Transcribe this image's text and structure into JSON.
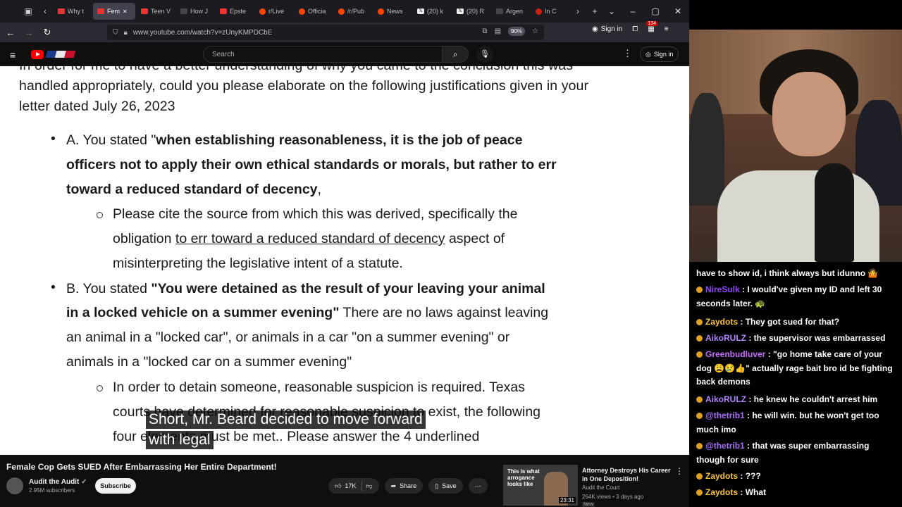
{
  "browser": {
    "tabs": [
      {
        "label": "Why t",
        "active": false,
        "icon": "youtube-icon"
      },
      {
        "label": "Fem",
        "active": true,
        "icon": "youtube-icon"
      },
      {
        "label": "Teen V",
        "active": false,
        "icon": "youtube-icon"
      },
      {
        "label": "How J",
        "active": false,
        "icon": "page-icon"
      },
      {
        "label": "Epste",
        "active": false,
        "icon": "youtube-icon"
      },
      {
        "label": "r/Live",
        "active": false,
        "icon": "reddit-icon"
      },
      {
        "label": "Officia",
        "active": false,
        "icon": "reddit-icon"
      },
      {
        "label": "/r/Pub",
        "active": false,
        "icon": "reddit-icon"
      },
      {
        "label": "News",
        "active": false,
        "icon": "reddit-icon"
      },
      {
        "label": "(20) k",
        "active": false,
        "icon": "x-icon"
      },
      {
        "label": "(20) R",
        "active": false,
        "icon": "x-icon"
      },
      {
        "label": "Argen",
        "active": false,
        "icon": "page-icon"
      },
      {
        "label": "In C",
        "active": false,
        "icon": "page-icon"
      }
    ],
    "url": "www.youtube.com/watch?v=zUnyKMPDCbE",
    "zoom": "90%",
    "signin_label": "Sign in",
    "extension_badge": "134"
  },
  "youtube": {
    "search_placeholder": "Search",
    "signin_label": "Sign in",
    "video_title": "Female Cop Gets SUED After Embarrassing Her Entire Department!",
    "channel_name": "Audit the Audit",
    "subscribers": "2.95M subscribers",
    "subscribe_label": "Subscribe",
    "likes": "17K",
    "share_label": "Share",
    "save_label": "Save",
    "recommended": {
      "thumb_text": "This is what arrogance looks like",
      "duration": "23:31",
      "title": "Attorney Destroys His Career in One Deposition!",
      "channel": "Audit the Court",
      "meta": "264K views • 3 days ago",
      "badge": "New"
    }
  },
  "document": {
    "line_top": "In order for me to have a better understanding of why you came to the conclusion this was",
    "line_1": "handled appropriately, could you please elaborate on the following justifications given in your",
    "line_2": "letter dated July 26, 2023",
    "a_1_prefix": "A. You stated \"",
    "a_1_bold": "when establishing reasonableness, it is the job of peace",
    "a_2": "officers not to apply their own ethical standards or morals, but rather to err",
    "a_3_bold": "toward a reduced standard of decency",
    "a_3_tail": ",",
    "a_sub_1": "Please cite the source from which this was derived, specifically the",
    "a_sub_2_pre": "obligation ",
    "a_sub_2_u": "to err toward a reduced standard of decency",
    "a_sub_2_post": " aspect of",
    "a_sub_3": "misinterpreting the legislative intent of a statute.",
    "b_1_prefix": "B. You stated ",
    "b_1_bold": "\"You were detained as the result of your leaving your animal",
    "b_2_bold": "in a locked vehicle on a summer evening\"",
    "b_2_tail": "  There are no laws against leaving",
    "b_3": "an animal in a \"locked car\",  or animals in a car \"on a summer evening\" or",
    "b_4": "animals in a \"locked car on a summer evening\"",
    "b_sub_1": "In order to detain someone, reasonable suspicion is required. Texas",
    "b_sub_2": "courts have determined for reasonable suspicion to exist, the following",
    "b_sub_3": "four elements must be met.. Please answer the 4 underlined"
  },
  "captions": {
    "line1": "Short, Mr. Beard decided to move forward",
    "line2": "with legal"
  },
  "chat": [
    {
      "user": "",
      "color": "#ffffff",
      "text": "have to show id, i think always but idunno 🤷"
    },
    {
      "user": "NireSulk",
      "color": "#9146ff",
      "text": "I would've given my ID and left 30 seconds later. 🐢"
    },
    {
      "user": "Zaydots",
      "color": "#f5c542",
      "text": "They got sued for that?"
    },
    {
      "user": "AikoRULZ",
      "color": "#b084ff",
      "text": "the supervisor was embarrassed"
    },
    {
      "user": "Greenbudluver",
      "color": "#c56cff",
      "text": "\"go home take care of your dog 😩😢👍\" actually rage bait bro id be fighting back demons"
    },
    {
      "user": "AikoRULZ",
      "color": "#b084ff",
      "text": "he knew he couldn't arrest him"
    },
    {
      "user": "@thetrib1",
      "color": "#a970ff",
      "text": "he will win. but he won't get too much imo"
    },
    {
      "user": "@thetrib1",
      "color": "#a970ff",
      "text": "that was super embarrassing though for sure"
    },
    {
      "user": "Zaydots",
      "color": "#f5c542",
      "text": "???"
    },
    {
      "user": "Zaydots",
      "color": "#f5c542",
      "text": "What"
    }
  ]
}
